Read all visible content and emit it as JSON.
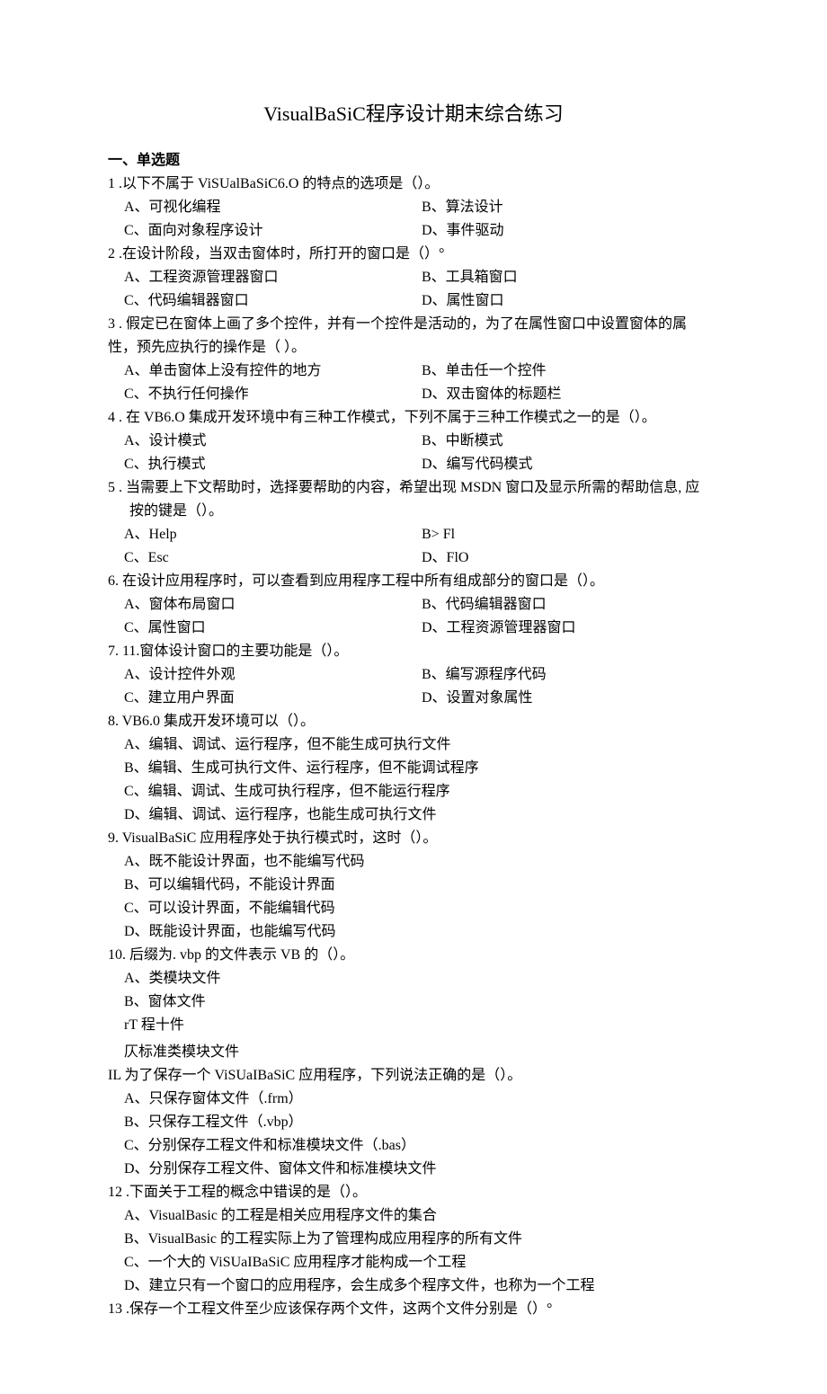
{
  "title_left": "VisualBaSiC",
  "title_right": "程序设计期末综合练习",
  "section_heading": "一、单选题",
  "q1": {
    "stem": "1  .以下不属于 ViSUalBaSiC6.O 的特点的选项是（）。",
    "a": "A、可视化编程",
    "b": "B、算法设计",
    "c": "C、面向对象程序设计",
    "d": "D、事件驱动"
  },
  "q2": {
    "stem": "2   .在设计阶段，当双击窗体时，所打开的窗口是（）°",
    "a": "A、工程资源管理器窗口",
    "b": "B、工具箱窗口",
    "c": "C、代码编辑器窗口",
    "d": "D、属性窗口"
  },
  "q3": {
    "stem1": "3   . 假定已在窗体上画了多个控件，并有一个控件是活动的，为了在属性窗口中设置窗体的属",
    "stem2": "性，预先应执行的操作是（       ）。",
    "a": "A、单击窗体上没有控件的地方",
    "b": "B、单击任一个控件",
    "c": "C、不执行任何操作",
    "d": "D、双击窗体的标题栏"
  },
  "q4": {
    "stem": "4   . 在 VB6.O 集成开发环境中有三种工作模式，下列不属于三种工作模式之一的是（）。",
    "a": "A、设计模式",
    "b": "B、中断模式",
    "c": "C、执行模式",
    "d": "D、编写代码模式"
  },
  "q5": {
    "stem1": "5  . 当需要上下文帮助时，选择要帮助的内容，希望出现 MSDN 窗口及显示所需的帮助信息, 应",
    "stem2": "按的键是（）。",
    "a": "A、Help",
    "b": "B>   Fl",
    "c": "C、Esc",
    "d": "D、FlO"
  },
  "q6": {
    "stem": "6.   在设计应用程序时，可以查看到应用程序工程中所有组成部分的窗口是（）。",
    "a": "A、窗体布局窗口",
    "b": "B、代码编辑器窗口",
    "c": "C、属性窗口",
    "d": "D、工程资源管理器窗口"
  },
  "q7": {
    "stem": "7.   11.窗体设计窗口的主要功能是（）。",
    "a": "A、设计控件外观",
    "b": "B、编写源程序代码",
    "c": "C、建立用户界面",
    "d": "D、设置对象属性"
  },
  "q8": {
    "stem": "8.   VB6.0 集成开发环境可以（）。",
    "a": "A、编辑、调试、运行程序，但不能生成可执行文件",
    "b": "B、编辑、生成可执行文件、运行程序，但不能调试程序",
    "c": "C、编辑、调试、生成可执行程序，但不能运行程序",
    "d": "D、编辑、调试、运行程序，也能生成可执行文件"
  },
  "q9": {
    "stem": "9.   VisualBaSiC 应用程序处于执行模式时，这时（）。",
    "a": "A、既不能设计界面，也不能编写代码",
    "b": "B、可以编辑代码，不能设计界面",
    "c": "C、可以设计界面，不能编辑代码",
    "d": "D、既能设计界面，也能编写代码"
  },
  "q10": {
    "stem": "10.   后缀为. vbp 的文件表示 VB 的（）。",
    "a": "A、类模块文件",
    "b": "B、窗体文件",
    "c": "rT 程十件",
    "d": "仄标准类模块文件"
  },
  "q11": {
    "stem": "IL 为了保存一个 ViSUaIBaSiC 应用程序，下列说法正确的是（）。",
    "a": "A、只保存窗体文件（.frm）",
    "b": "B、只保存工程文件（.vbp）",
    "c": "C、分别保存工程文件和标准模块文件（.bas）",
    "d": "D、分别保存工程文件、窗体文件和标准模块文件"
  },
  "q12": {
    "stem": "12   .下面关于工程的概念中错误的是（）。",
    "a": "A、VisualBasic 的工程是相关应用程序文件的集合",
    "b": "B、VisualBasic 的工程实际上为了管理构成应用程序的所有文件",
    "c": "C、一个大的 ViSUaIBaSiC 应用程序才能构成一个工程",
    "d": "D、建立只有一个窗口的应用程序，会生成多个程序文件，也称为一个工程"
  },
  "q13": {
    "stem": "13   .保存一个工程文件至少应该保存两个文件，这两个文件分别是（）°"
  }
}
